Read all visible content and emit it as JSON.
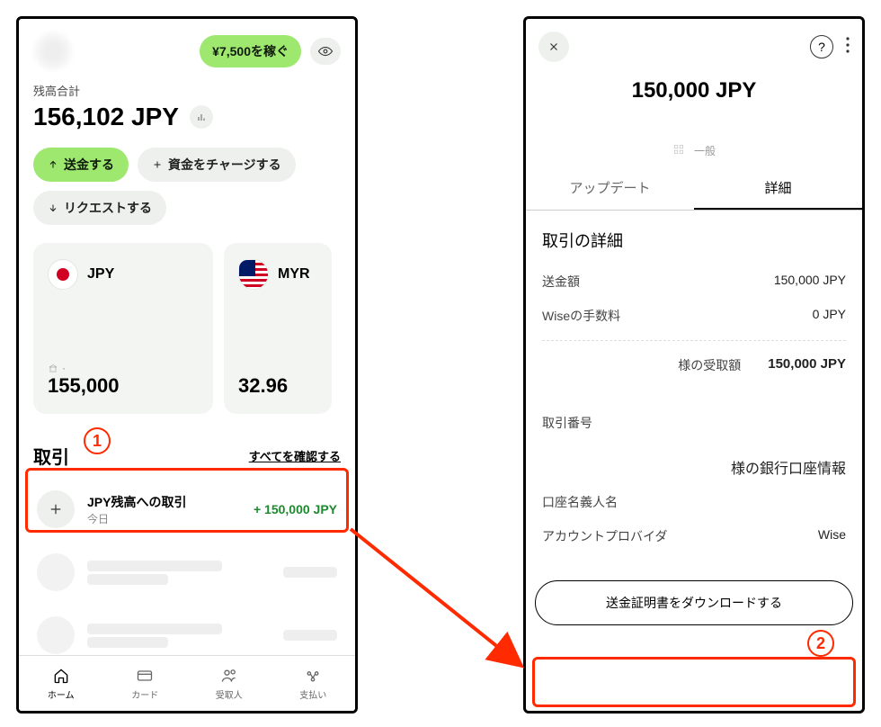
{
  "left": {
    "earn_label": "¥7,500を稼ぐ",
    "balance_label": "残高合計",
    "balance_amount": "156,102 JPY",
    "actions": {
      "send": "送金する",
      "charge": "資金をチャージする",
      "request": "リクエストする"
    },
    "currencies": [
      {
        "code": "JPY",
        "amount": "155,000",
        "meta_icon": "bank-icon"
      },
      {
        "code": "MYR",
        "amount": "32.96"
      }
    ],
    "tx_header": "取引",
    "tx_see_all": "すべてを確認する",
    "tx": {
      "title": "JPY残高への取引",
      "when": "今日",
      "amount": "+ 150,000 JPY"
    },
    "nav": [
      "ホーム",
      "カード",
      "受取人",
      "支払い"
    ]
  },
  "right": {
    "amount": "150,000 JPY",
    "segment_label": "一般",
    "tabs": {
      "updates": "アップデート",
      "details": "詳細"
    },
    "section_title": "取引の詳細",
    "rows": {
      "sent_label": "送金額",
      "sent_value": "150,000 JPY",
      "fee_label": "Wiseの手数料",
      "fee_value": "0 JPY",
      "recv_label": "様の受取額",
      "recv_value": "150,000 JPY",
      "txno_label": "取引番号"
    },
    "bank_title": "様の銀行口座情報",
    "bank_rows": {
      "holder_label": "口座名義人名",
      "provider_label": "アカウントプロバイダ",
      "provider_value": "Wise"
    },
    "download_btn": "送金証明書をダウンロードする"
  },
  "anno": {
    "one": "1",
    "two": "2"
  }
}
